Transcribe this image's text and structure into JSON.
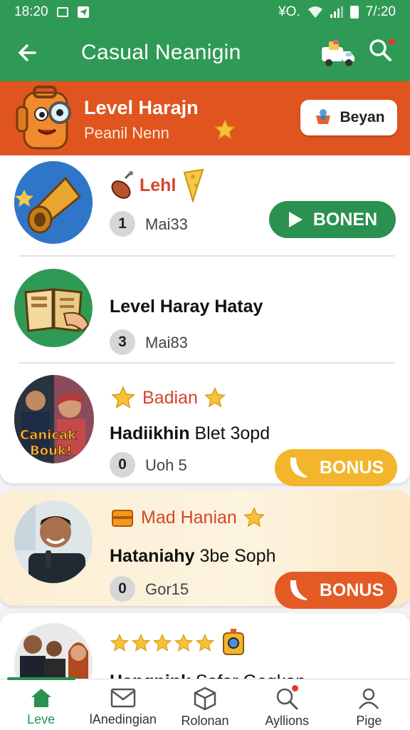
{
  "status_bar": {
    "time_left": "18:20",
    "time_right": "7/:20",
    "indicator_text": "¥O."
  },
  "app_bar": {
    "title": "Casual Neanigin"
  },
  "banner": {
    "title": "Level Harajn",
    "subtitle": "Peanil Nenn",
    "button_label": "Beyan"
  },
  "items": [
    {
      "kicker": "Lehl",
      "title": "",
      "count": "1",
      "meta": "Mai33",
      "button_label": "BONEN"
    },
    {
      "kicker": "",
      "title": "Level Haray Hatay",
      "count": "3",
      "meta": "Mai83",
      "button_label": ""
    },
    {
      "kicker": "Badian",
      "title_bold": "Hadiikhin",
      "title_light": "Blet 3opd",
      "count": "0",
      "meta": "Uoh 5",
      "button_label": "BONUS",
      "thumb_text_1": "Canicak",
      "thumb_text_2": "Bouk!"
    },
    {
      "kicker": "Mad Hanian",
      "title_bold": "Hataniahy",
      "title_light": "3be Soph",
      "count": "0",
      "meta": "Gor15",
      "button_label": "BONUS"
    },
    {
      "kicker": "",
      "title_bold": "Hangnink",
      "title_light": "Safar Gegkan",
      "stars": 5
    }
  ],
  "bottom_nav": [
    {
      "label": "Leve",
      "icon": "home-icon",
      "active": true
    },
    {
      "label": "lAnedingian",
      "icon": "mail-icon",
      "active": false
    },
    {
      "label": "Rolonan",
      "icon": "box-icon",
      "active": false
    },
    {
      "label": "Ayllions",
      "icon": "search-icon",
      "active": false
    },
    {
      "label": "Pige",
      "icon": "profile-icon",
      "active": false
    }
  ],
  "colors": {
    "primary_green": "#2f9a55",
    "banner_orange": "#e0551f",
    "button_green": "#2a9150",
    "button_yellow": "#f3b52b",
    "button_orange": "#e35a25",
    "kicker_red": "#d4452a"
  }
}
